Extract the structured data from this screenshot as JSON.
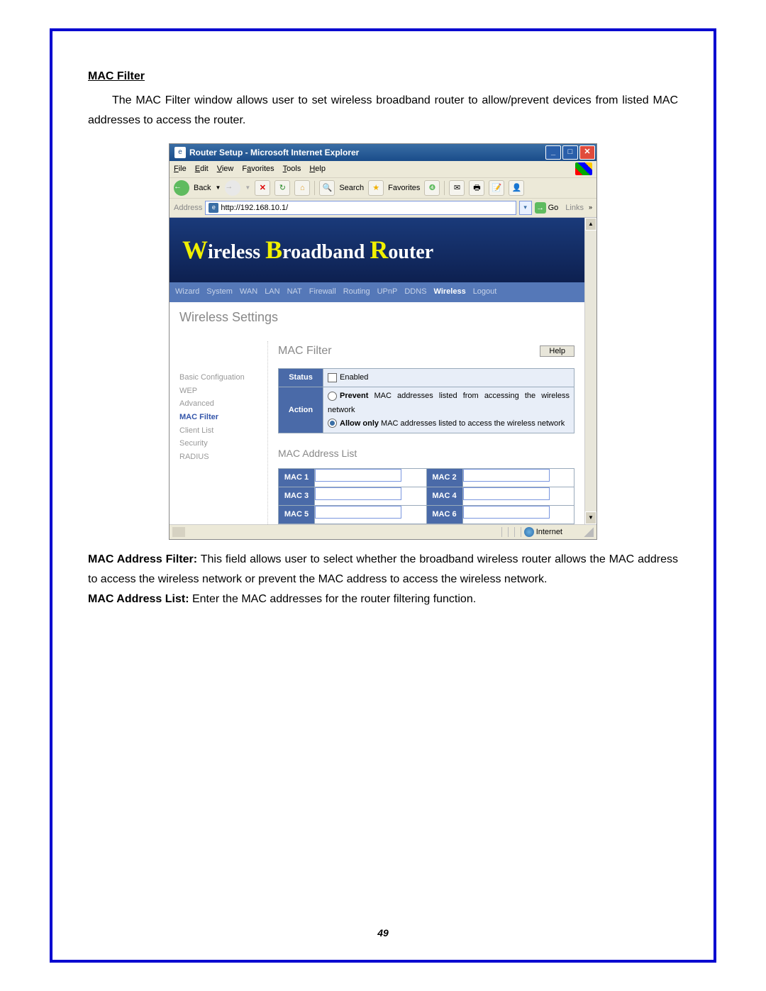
{
  "doc": {
    "heading": "MAC Filter",
    "intro": "The MAC Filter window allows user to set wireless broadband router to allow/prevent devices from listed MAC addresses to access the router.",
    "filter_label": "MAC Address Filter:",
    "filter_text": " This field allows user to select whether the broadband wireless router allows the MAC address to access the wireless network or prevent the MAC address to access the wireless network.",
    "list_label": "MAC Address List:",
    "list_text": " Enter the MAC addresses for the router filtering function.",
    "page_num": "49"
  },
  "win": {
    "title": "Router Setup - Microsoft Internet Explorer",
    "menu": [
      "File",
      "Edit",
      "View",
      "Favorites",
      "Tools",
      "Help"
    ],
    "back": "Back",
    "search": "Search",
    "favorites": "Favorites",
    "addr_label": "Address",
    "url": "http://192.168.10.1/",
    "go": "Go",
    "links": "Links"
  },
  "router": {
    "banner_w": "W",
    "banner_1": "ireless ",
    "banner_b": "B",
    "banner_2": "roadband ",
    "banner_r": "R",
    "banner_3": "outer",
    "nav": [
      "Wizard",
      "System",
      "WAN",
      "LAN",
      "NAT",
      "Firewall",
      "Routing",
      "UPnP",
      "DDNS",
      "Wireless",
      "Logout"
    ],
    "page_title": "Wireless Settings",
    "side": [
      "Basic Configuation",
      "WEP",
      "Advanced",
      "MAC Filter",
      "Client List",
      "Security",
      "RADIUS"
    ],
    "panel_title": "MAC Filter",
    "help": "Help",
    "status_lbl": "Status",
    "enabled": "Enabled",
    "action_lbl": "Action",
    "prevent_b": "Prevent",
    "prevent_t": " MAC addresses listed from accessing the wireless network",
    "allow_b": "Allow only",
    "allow_t": " MAC addresses listed to access the wireless network",
    "list_title": "MAC Address List",
    "mac": [
      "MAC 1",
      "MAC 2",
      "MAC 3",
      "MAC 4",
      "MAC 5",
      "MAC 6"
    ]
  },
  "status": {
    "zone": "Internet"
  }
}
